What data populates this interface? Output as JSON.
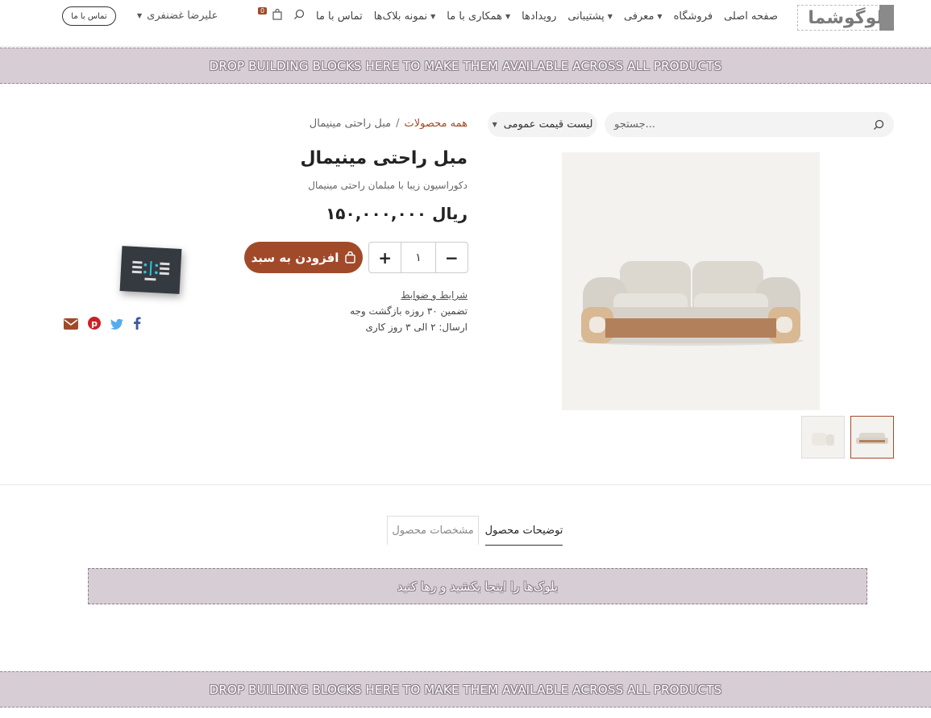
{
  "header": {
    "logo_text": "لوگوشما",
    "nav": [
      {
        "label": "صفحه اصلی",
        "dropdown": false
      },
      {
        "label": "فروشگاه",
        "dropdown": false
      },
      {
        "label": "معرفی",
        "dropdown": true
      },
      {
        "label": "پشتیبانی",
        "dropdown": true
      },
      {
        "label": "رویدادها",
        "dropdown": false
      },
      {
        "label": "همکاری با ما",
        "dropdown": true
      },
      {
        "label": "نمونه بلاک‌ها",
        "dropdown": true
      },
      {
        "label": "تماس با ما",
        "dropdown": false
      }
    ],
    "cart_count": "0",
    "user_name": "علیرضا غضنفری",
    "contact_button": "تماس با ما"
  },
  "dropzone_text": "DROP BUILDING BLOCKS HERE TO MAKE THEM AVAILABLE ACROSS ALL PRODUCTS",
  "search": {
    "placeholder": "جستجو..."
  },
  "pricelist": {
    "label": "لیست قیمت عمومی"
  },
  "breadcrumb": {
    "parent": "همه محصولات",
    "separator": "/",
    "current": "مبل راحتی مینیمال"
  },
  "product": {
    "title": "مبل راحتی مینیمال",
    "subtitle": "دکوراسیون زیبا با مبلمان راحتی مینیمال",
    "price": "۱۵۰,۰۰۰,۰۰۰ ریال",
    "quantity": "۱",
    "add_to_cart": "افزودن به سبد",
    "terms": "شرایط و ضوابط",
    "guarantee": "تضمین ۳۰ روزه بازگشت وجه",
    "shipping": "ارسال: ۲ الی ۳ روز کاری"
  },
  "tabs": {
    "description": "توضیحات محصول",
    "specs": "مشخصات محصول"
  },
  "block_drop_text": "بلوک‌ها را اینجا بکشید و رها کنید",
  "colors": {
    "accent": "#a04a2a",
    "dropzone": "#d7cdd4",
    "facebook": "#3b5998",
    "twitter": "#55acee",
    "pinterest": "#cb2027",
    "email": "#a04a2a"
  }
}
